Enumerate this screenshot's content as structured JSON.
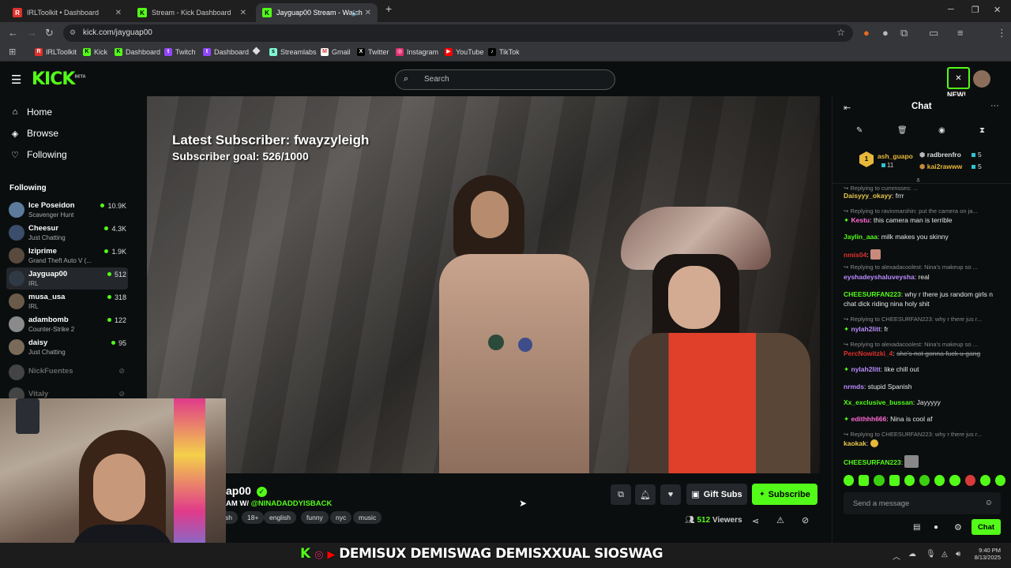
{
  "browser": {
    "tabs": [
      {
        "title": "IRLToolkit • Dashboard",
        "color": "#e0312c",
        "glyph": "R"
      },
      {
        "title": "Stream - Kick Dashboard",
        "color": "#53fc18",
        "glyph": "K"
      },
      {
        "title": "Jayguap00 Stream - Watch",
        "color": "#53fc18",
        "glyph": "K"
      }
    ],
    "url": "kick.com/jayguap00",
    "bookmarks": [
      "IRLToolkit",
      "Kick",
      "Dashboard",
      "Twitch",
      "Dashboard",
      "",
      "Streamlabs",
      "Gmail",
      "Twitter",
      "Instagram",
      "YouTube",
      "TikTok"
    ]
  },
  "header": {
    "logo": "KICK",
    "logo_beta": "BETA",
    "search_placeholder": "Search",
    "new_badge": "NEW!"
  },
  "sidebar": {
    "nav": [
      {
        "label": "Home",
        "icon": "⌂"
      },
      {
        "label": "Browse",
        "icon": "◈"
      },
      {
        "label": "Following",
        "icon": "♡"
      }
    ],
    "following_title": "Following",
    "channels": [
      {
        "name": "Ice Poseidon",
        "category": "Scavenger Hunt",
        "viewers": "10.9K"
      },
      {
        "name": "Cheesur",
        "category": "Just Chatting",
        "viewers": "4.3K"
      },
      {
        "name": "Iziprime",
        "category": "Grand Theft Auto V (...",
        "viewers": "1.9K"
      },
      {
        "name": "Jayguap00",
        "category": "IRL",
        "viewers": "512"
      },
      {
        "name": "musa_usa",
        "category": "IRL",
        "viewers": "318"
      },
      {
        "name": "adambomb",
        "category": "Counter-Strike 2",
        "viewers": "122"
      },
      {
        "name": "daisy",
        "category": "Just Chatting",
        "viewers": "95"
      },
      {
        "name": "NickFuentes",
        "category": "",
        "viewers": ""
      },
      {
        "name": "Vitaly",
        "category": "",
        "viewers": ""
      }
    ]
  },
  "video": {
    "overlay_line1": "Latest Subscriber: fwayzyleigh",
    "overlay_line2": "Subscriber goal: 526/1000"
  },
  "stream": {
    "channel_partial": "ap00",
    "title_partial": "AM W/",
    "mention": "@NINADADDYISBACK",
    "tags": [
      "sh",
      "18+",
      "english",
      "funny",
      "nyc",
      "music"
    ],
    "gift_label": "Gift Subs",
    "subscribe_label": "Subscribe",
    "viewers_count": "512",
    "viewers_label": "Viewers"
  },
  "chat": {
    "title": "Chat",
    "leaders": [
      {
        "name": "ash_guapo",
        "count": "11"
      },
      {
        "name": "radbrenfro",
        "count": "5"
      },
      {
        "name": "kai2rawww",
        "count": "5"
      }
    ],
    "messages": [
      {
        "kind": "reply",
        "text": "Replying to cummsses: ..."
      },
      {
        "kind": "msg",
        "user": "Daisyyy_okayy",
        "color": "#e8c84a",
        "text": "frrr"
      },
      {
        "kind": "reply",
        "text": "Replying to ravinmarshin: put the camera on ja..."
      },
      {
        "kind": "msg",
        "user": "Kestu",
        "color": "#ff6ad5",
        "text": "this camera man is terrible"
      },
      {
        "kind": "msg",
        "user": "Jaylin_aaa",
        "color": "#53fc18",
        "text": "milk makes you skinny"
      },
      {
        "kind": "msg",
        "user": "nmis04",
        "color": "#e0312c",
        "text": ""
      },
      {
        "kind": "reply",
        "text": "Replying to alexadacoolest: Nina's makeup so ..."
      },
      {
        "kind": "msg",
        "user": "eyshadeyshaluveysha",
        "color": "#b98cff",
        "text": "real"
      },
      {
        "kind": "msg",
        "user": "CHEESURFAN223",
        "color": "#53fc18",
        "text": "why r there jus random girls n chat dick riding nina holy shit"
      },
      {
        "kind": "reply",
        "text": "Replying to CHEESURFAN223: why r there jus r..."
      },
      {
        "kind": "msg",
        "user": "nylah2litt",
        "color": "#b98cff",
        "text": "fr"
      },
      {
        "kind": "reply",
        "text": "Replying to alexadacoolest: Nina's makeup so ..."
      },
      {
        "kind": "msg",
        "user": "PercNowitzki_4",
        "color": "#e0312c",
        "text": "she's not gonna fuck u gang"
      },
      {
        "kind": "msg",
        "user": "nylah2litt",
        "color": "#b98cff",
        "text": "like chill out"
      },
      {
        "kind": "msg",
        "user": "nrmds",
        "color": "#b98cff",
        "text": "stupid Spanish"
      },
      {
        "kind": "msg",
        "user": "Xx_exclusive_bussan",
        "color": "#53fc18",
        "text": "Jayyyyy"
      },
      {
        "kind": "msg",
        "user": "edithhh666",
        "color": "#ff6ad5",
        "text": "Nina is cool af"
      },
      {
        "kind": "reply",
        "text": "Replying to CHEESURFAN223: why r there jus r..."
      },
      {
        "kind": "msg",
        "user": "kaokak",
        "color": "#e8c84a",
        "text": ""
      },
      {
        "kind": "msg",
        "user": "CHEESURFAN223",
        "color": "#53fc18",
        "text": ""
      }
    ],
    "send_placeholder": "Send a message",
    "chat_button": "Chat"
  },
  "taskbar": {
    "marquee": "DEMISUX  DEMISWAG  DEMISXXUAL  SIOSWAG",
    "time": "9:40 PM",
    "date": "8/13/2025"
  }
}
